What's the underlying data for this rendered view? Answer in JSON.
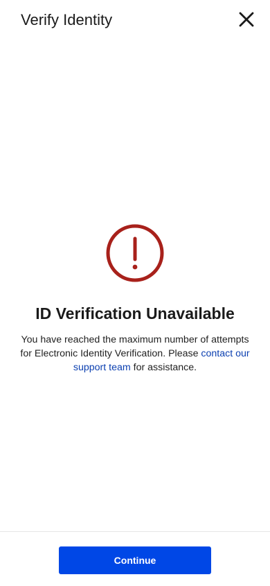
{
  "header": {
    "title": "Verify Identity",
    "close_icon": "close-icon"
  },
  "status": {
    "icon": "exclamation-circle-icon",
    "icon_color": "#a8211b",
    "title": "ID Verification Unavailable",
    "message_before": "You have reached the maximum number of attempts for Electronic Identity Verification. Please ",
    "message_link": "contact our support team",
    "message_after": " for assistance."
  },
  "footer": {
    "continue_label": "Continue",
    "button_color": "#0047e6"
  }
}
